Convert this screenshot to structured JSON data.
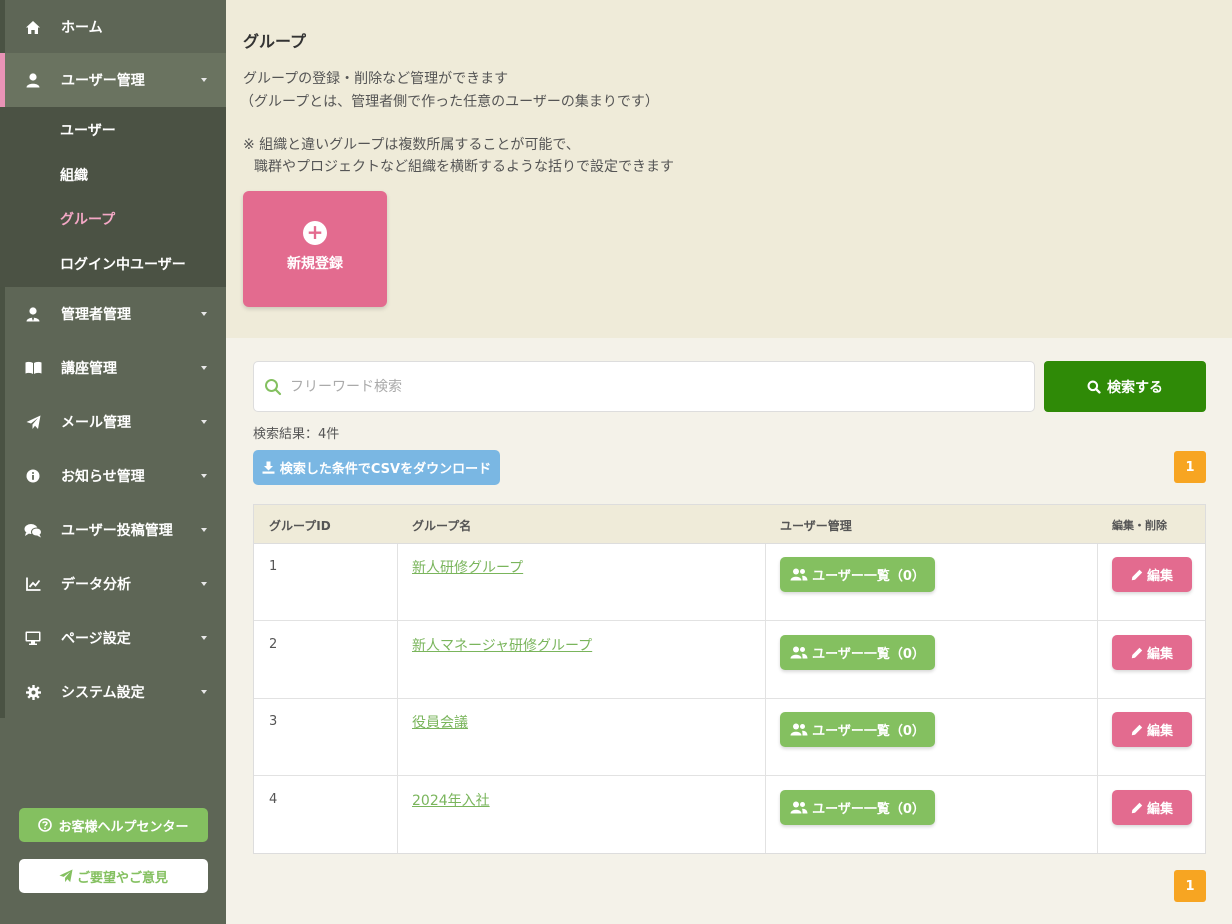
{
  "sidebar": {
    "items": [
      {
        "label": "ホーム",
        "icon": "home-icon"
      },
      {
        "label": "ユーザー管理",
        "icon": "user-icon"
      },
      {
        "label": "管理者管理",
        "icon": "admin-icon"
      },
      {
        "label": "講座管理",
        "icon": "book-icon"
      },
      {
        "label": "メール管理",
        "icon": "paper-plane-icon"
      },
      {
        "label": "お知らせ管理",
        "icon": "info-icon"
      },
      {
        "label": "ユーザー投稿管理",
        "icon": "comments-icon"
      },
      {
        "label": "データ分析",
        "icon": "chart-line-icon"
      },
      {
        "label": "ページ設定",
        "icon": "monitor-icon"
      },
      {
        "label": "システム設定",
        "icon": "gear-icon"
      }
    ],
    "submenu": [
      {
        "label": "ユーザー"
      },
      {
        "label": "組織"
      },
      {
        "label": "グループ"
      },
      {
        "label": "ログイン中ユーザー"
      }
    ],
    "help_label": "お客様ヘルプセンター",
    "feedback_label": "ご要望やご意見"
  },
  "header": {
    "title": "グループ",
    "description_lines": [
      "グループの登録・削除など管理ができます",
      "（グループとは、管理者側で作った任意のユーザーの集まりです）",
      "※ 組織と違いグループは複数所属することが可能で、",
      "職群やプロジェクトなど組織を横断するような括りで設定できます"
    ],
    "new_button_label": "新規登録"
  },
  "search": {
    "placeholder": "フリーワード検索",
    "value": "",
    "button_label": "検索する",
    "result_count": "検索結果：4件",
    "csv_button_label": "検索した条件でCSVをダウンロード"
  },
  "pagination": {
    "current_page": "1"
  },
  "table": {
    "headers": [
      "グループID",
      "グループ名",
      "ユーザー管理",
      "編集・削除"
    ],
    "rows": [
      {
        "id": "1",
        "name": "新人研修グループ",
        "users_label": "ユーザー一覧（0）",
        "edit_label": "編集"
      },
      {
        "id": "2",
        "name": "新人マネージャ研修グループ",
        "users_label": "ユーザー一覧（0）",
        "edit_label": "編集"
      },
      {
        "id": "3",
        "name": "役員会議",
        "users_label": "ユーザー一覧（0）",
        "edit_label": "編集"
      },
      {
        "id": "4",
        "name": "2024年入社",
        "users_label": "ユーザー一覧（0）",
        "edit_label": "編集"
      }
    ]
  },
  "colors": {
    "sidebar_bg": "#5e6656",
    "submenu_bg": "#4b5244",
    "active_accent": "#e993b6",
    "pink_button": "#e36b8f",
    "green_button": "#84c060",
    "search_button": "#2f8a07",
    "csv_button": "#7ab7e3",
    "pagination": "#f7a522"
  }
}
